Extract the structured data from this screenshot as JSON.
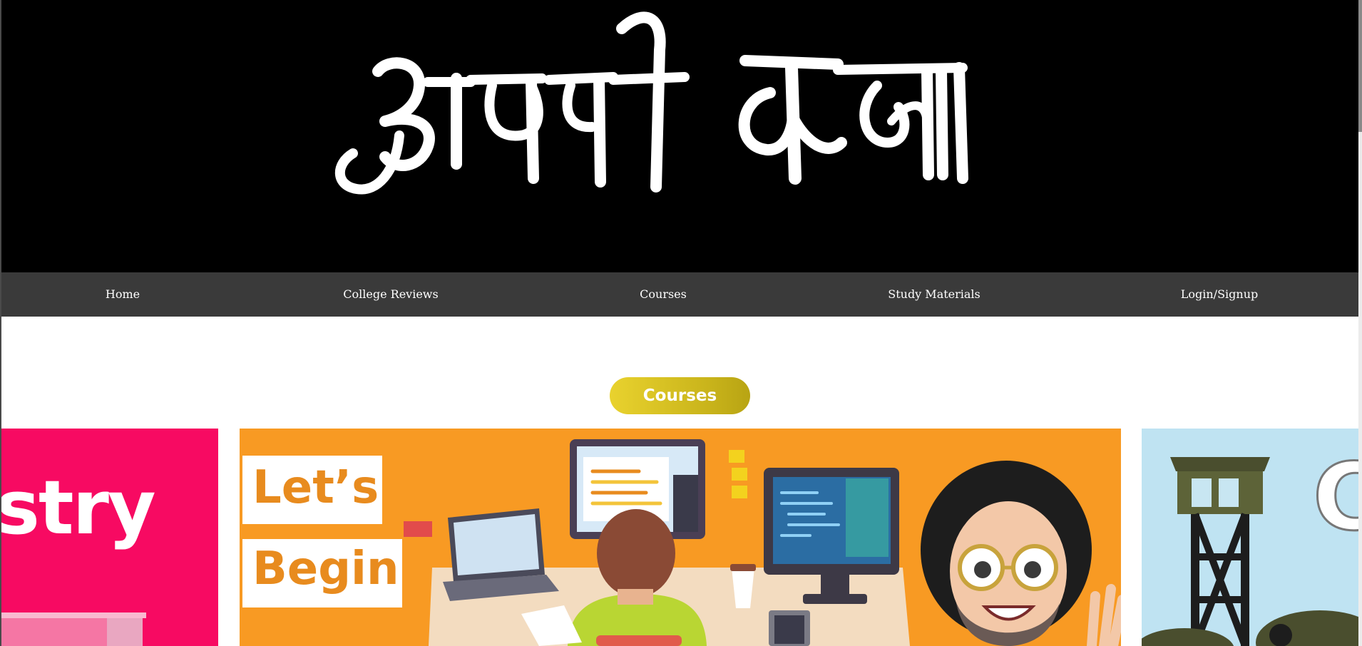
{
  "header": {
    "logo_text": "अपनी कक्षा"
  },
  "nav": {
    "items": [
      {
        "label": "Home"
      },
      {
        "label": "College Reviews"
      },
      {
        "label": "Courses"
      },
      {
        "label": "Study Materials"
      },
      {
        "label": "Login/Signup"
      }
    ]
  },
  "main": {
    "section_button": "Courses",
    "cards": [
      {
        "visible_text": "stry"
      },
      {
        "line1": "Let’s",
        "line2": "Begin"
      },
      {
        "visible_text": "C"
      }
    ]
  },
  "colors": {
    "banner_bg": "#000000",
    "nav_bg": "#3a3a3a",
    "button_gradient_start": "#e9d22e",
    "button_gradient_end": "#b8a413",
    "card_pink": "#f70a62",
    "card_orange": "#f89a23",
    "card_sky": "#bfe3f2"
  }
}
